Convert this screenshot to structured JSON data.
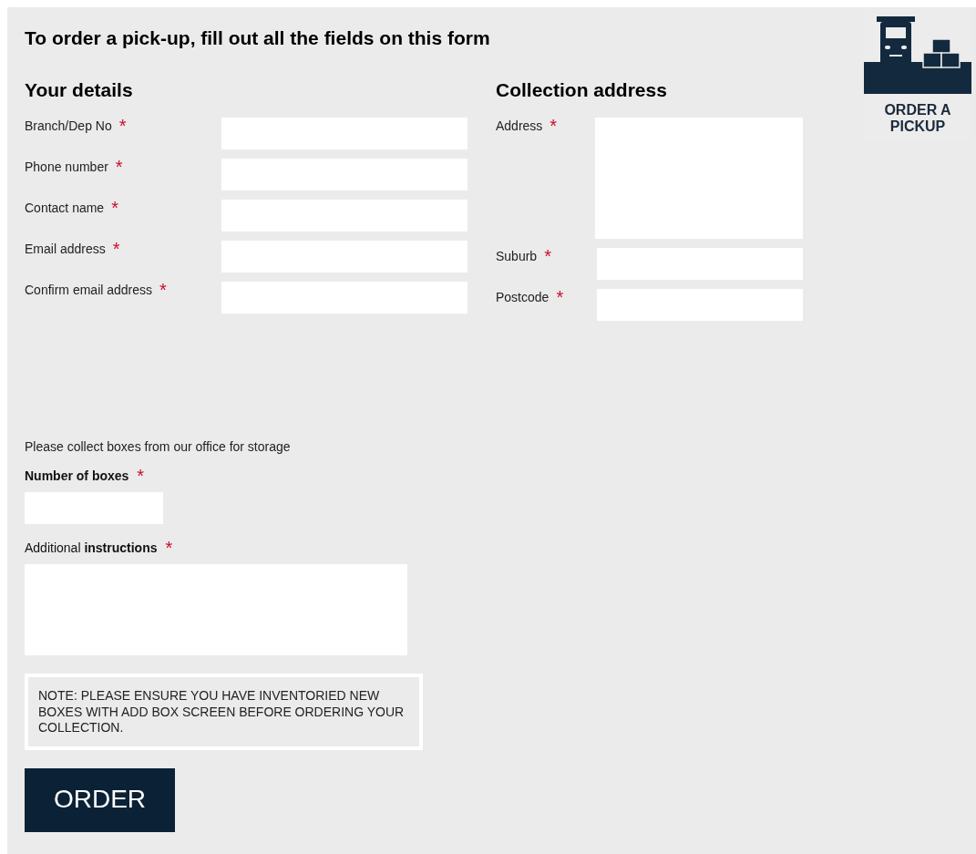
{
  "form_title": "To order a pick-up, fill out all the fields on this form",
  "badge": {
    "label": "ORDER A PICKUP"
  },
  "your_details": {
    "heading": "Your details",
    "fields": [
      {
        "label": "Branch/Dep No",
        "mark": "*"
      },
      {
        "label": "Phone number",
        "mark": "*"
      },
      {
        "label": "Contact name",
        "mark": "*"
      },
      {
        "label": "Email address",
        "mark": "*"
      },
      {
        "label": "Confirm email address",
        "mark": "*"
      }
    ]
  },
  "collection_address": {
    "heading": "Collection address",
    "fields": [
      {
        "label": "Address",
        "mark": "*",
        "kind": "textarea"
      },
      {
        "label": "Suburb",
        "mark": "*",
        "kind": "input"
      },
      {
        "label": "Postcode",
        "mark": "*",
        "kind": "input"
      }
    ]
  },
  "intro": "Please collect boxes from our office for storage",
  "boxes": {
    "label": "Number of boxes",
    "mark": "*"
  },
  "instructions": {
    "label": "Additional **instructions**",
    "mark": "*"
  },
  "note": "NOTE: PLEASE ENSURE YOU HAVE INVENTORIED NEW BOXES WITH ADD BOX SCREEN BEFORE ORDERING YOUR COLLECTION.",
  "order_button": "ORDER"
}
